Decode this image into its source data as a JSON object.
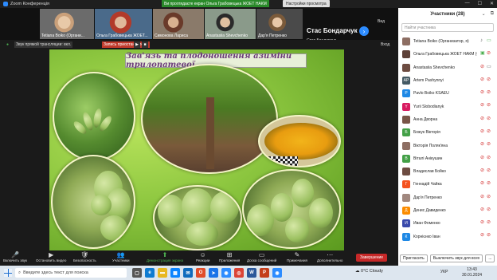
{
  "window": {
    "title": "Zoom Конференція",
    "share_banner": "Ви проглядаєте екран Ольга Грабовецька ЖОЕТ НАКМ",
    "share_settings": "Настройки просмотра",
    "controls": [
      "—",
      "☐",
      "✕"
    ]
  },
  "strip": {
    "thumbs": [
      {
        "name": "Tetiana Boiko (Органи..."
      },
      {
        "name": "Ольга Грабовецька ЖОЕТ..."
      },
      {
        "name": "Симонова Лариса"
      },
      {
        "name": "Anastasiia Shevchenko"
      },
      {
        "name": "Дар'я Петренко"
      }
    ],
    "big_name": "Стас Бондарчук",
    "big_sub": "Стас Бондарчук",
    "view_label": "Вид",
    "next_glyph": "›"
  },
  "status": {
    "security_label": "Звук прямой трансляции: вкл.",
    "recording": "Запись приостановлена",
    "enter_label": "Вход"
  },
  "slide": {
    "title": "Зав'язь та плодоношення азиміни трилопатевої"
  },
  "participants": {
    "header": "Участники (28)",
    "search_placeholder": "Найти участника",
    "list": [
      {
        "name": "Tetiana Boiko (Организатор, я)",
        "initial": "",
        "color": "#8d6e63"
      },
      {
        "name": "Ольга Грабовецька ЖОЕТ НАКМ (Ор...",
        "initial": "",
        "color": "#5d4037"
      },
      {
        "name": "Anastasiia Shevchenko",
        "initial": "",
        "color": "#6d4c41"
      },
      {
        "name": "Artem Pashynnyi",
        "initial": "AP",
        "color": "#455a64"
      },
      {
        "name": "Pavlo Boiko KSAEU",
        "initial": "P",
        "color": "#1e88e5"
      },
      {
        "name": "Yurii Slobodianyk",
        "initial": "Y",
        "color": "#d81b60"
      },
      {
        "name": "Анна Дворна",
        "initial": "",
        "color": "#795548"
      },
      {
        "name": "Божук Вікторія",
        "initial": "Б",
        "color": "#43a047"
      },
      {
        "name": "Вікторія Поляк'яна",
        "initial": "",
        "color": "#8d6e63"
      },
      {
        "name": "Віталі Анікушин",
        "initial": "В",
        "color": "#43a047"
      },
      {
        "name": "Владислав Бойко",
        "initial": "",
        "color": "#6d4c41"
      },
      {
        "name": "Геннадій Чайка",
        "initial": "Г",
        "color": "#f4511e"
      },
      {
        "name": "Дар'я Петренко",
        "initial": "",
        "color": "#a1887f"
      },
      {
        "name": "Денис Давиденко",
        "initial": "Д",
        "color": "#fb8c00"
      },
      {
        "name": "Иван Фоменко",
        "initial": "И",
        "color": "#3949ab"
      },
      {
        "name": "Корнієнко Іван",
        "initial": "К",
        "color": "#1e88e5"
      }
    ],
    "invite": "Пригласить",
    "mute_all": "Выключить звук для всех",
    "more": "..."
  },
  "toolbar": {
    "items": [
      {
        "label": "Включить звук",
        "icon": "🎤"
      },
      {
        "label": "Остановить видео",
        "icon": "▶"
      },
      {
        "label": "Безопасность",
        "icon": "🛡"
      },
      {
        "label": "Участники",
        "icon": "👥"
      },
      {
        "label": "Демонстрация экрана",
        "icon": "⬆"
      },
      {
        "label": "Реакции",
        "icon": "☺"
      },
      {
        "label": "Приложения",
        "icon": "⊞"
      },
      {
        "label": "Доска сообщений",
        "icon": "▭"
      },
      {
        "label": "Примечания",
        "icon": "✎"
      },
      {
        "label": "Дополнительно",
        "icon": "⋯"
      }
    ],
    "end": "Завершение"
  },
  "taskbar": {
    "search": "Введите здесь текст для поиска",
    "weather": "0°C Cloudy",
    "lang": "УКР",
    "time": "13:43",
    "date": "30.01.2024"
  }
}
